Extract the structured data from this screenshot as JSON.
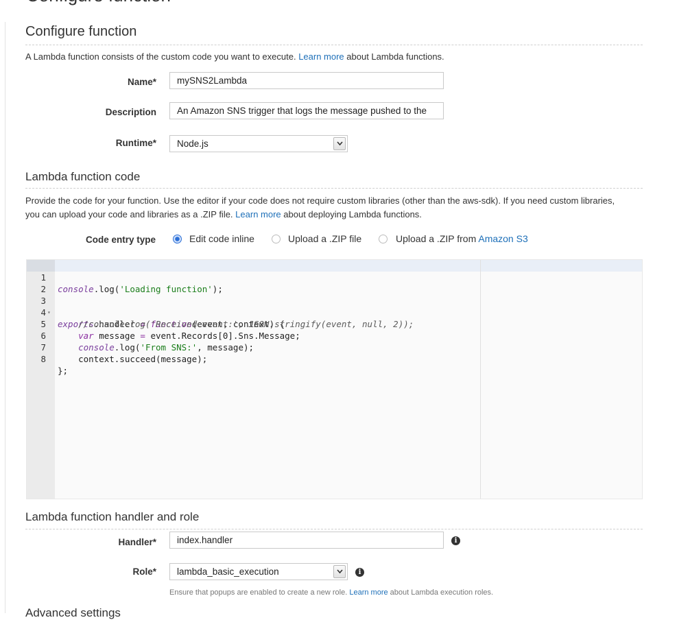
{
  "top_cut_title": "Configure function",
  "configure": {
    "title": "Configure function",
    "intro_before": "A Lambda function consists of the custom code you want to execute. ",
    "intro_link": "Learn more",
    "intro_after": " about Lambda functions.",
    "name_label": "Name*",
    "name_value": "mySNS2Lambda",
    "description_label": "Description",
    "description_value": "An Amazon SNS trigger that logs the message pushed to the",
    "runtime_label": "Runtime*",
    "runtime_value": "Node.js"
  },
  "code_section": {
    "title": "Lambda function code",
    "intro_before": "Provide the code for your function. Use the editor if your code does not require custom libraries (other than the aws-sdk). If you need custom libraries, you can upload your code and libraries as a .ZIP file. ",
    "intro_link": "Learn more",
    "intro_after": " about deploying Lambda functions.",
    "entry_type_label": "Code entry type",
    "options": [
      {
        "label": "Edit code inline",
        "selected": true
      },
      {
        "label": "Upload a .ZIP file",
        "selected": false
      },
      {
        "label_before": "Upload a .ZIP from ",
        "label_link": "Amazon S3",
        "selected": false
      }
    ]
  },
  "editor": {
    "lines": [
      {
        "n": "1"
      },
      {
        "n": "2"
      },
      {
        "n": "3",
        "fold": "▾"
      },
      {
        "n": "4"
      },
      {
        "n": "5"
      },
      {
        "n": "6"
      },
      {
        "n": "7"
      },
      {
        "n": "8"
      }
    ],
    "tokens": {
      "l1_a": "console",
      "l1_b": ".log(",
      "l1_c": "'Loading function'",
      "l1_d": ");",
      "l3_a": "exports",
      "l3_b": ".handler ",
      "l3_c": "=",
      "l3_d": " ",
      "l3_e": "function",
      "l3_f": "(event, context) {",
      "l4_a": "    //console.log('Received event:', JSON.stringify(event, null, 2));",
      "l5_a": "    ",
      "l5_b": "var",
      "l5_c": " message ",
      "l5_d": "=",
      "l5_e": " event.Records[0].Sns.Message;",
      "l6_a": "    ",
      "l6_b": "console",
      "l6_c": ".log(",
      "l6_d": "'From SNS:'",
      "l6_e": ", message);",
      "l7_a": "    context.succeed(message);",
      "l8_a": "};"
    }
  },
  "handler_section": {
    "title": "Lambda function handler and role",
    "handler_label": "Handler*",
    "handler_value": "index.handler",
    "role_label": "Role*",
    "role_value": "lambda_basic_execution",
    "help_before": "Ensure that popups are enabled to create a new role. ",
    "help_link": "Learn more",
    "help_after": " about Lambda execution roles."
  },
  "next_section_cut": "Advanced settings",
  "icons": {
    "info": "info-icon",
    "dropdown": "chevron-down-icon"
  },
  "colors": {
    "link": "#1d6fb8",
    "radio_selected": "#2b6fd6"
  }
}
